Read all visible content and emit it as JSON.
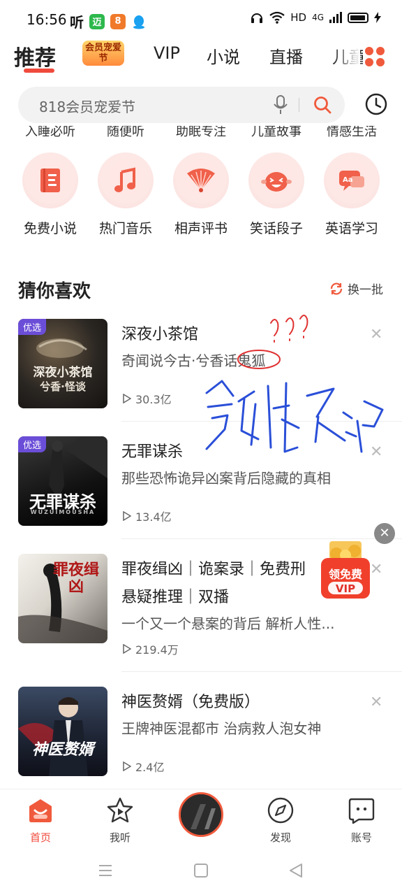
{
  "status_bar": {
    "time": "16:56",
    "app_icons": [
      "听",
      "迈",
      "8"
    ],
    "network": "HD",
    "signal": "4G"
  },
  "tabs": [
    {
      "label": "推荐",
      "active": true
    },
    {
      "label": "会员宠爱节",
      "promo": true
    },
    {
      "label": "VIP"
    },
    {
      "label": "小说"
    },
    {
      "label": "直播"
    },
    {
      "label": "儿童"
    }
  ],
  "search": {
    "placeholder": "818会员宠爱节"
  },
  "categories_top_cut": [
    "入睡必听",
    "随便听",
    "助眠专注",
    "儿童故事",
    "情感生活"
  ],
  "categories": [
    {
      "label": "免费小说",
      "icon": "book-icon"
    },
    {
      "label": "热门音乐",
      "icon": "music-icon"
    },
    {
      "label": "相声评书",
      "icon": "fan-icon"
    },
    {
      "label": "笑话段子",
      "icon": "laugh-icon"
    },
    {
      "label": "英语学习",
      "icon": "english-icon"
    }
  ],
  "section": {
    "title": "猜你喜欢",
    "refresh": "换一批"
  },
  "items": [
    {
      "tag": "优选",
      "cover_text": "深夜小茶馆",
      "cover_sub": "兮香·怪谈",
      "title": "深夜小茶馆",
      "desc": "奇闻说今古·兮香话鬼狐",
      "plays": "30.3亿"
    },
    {
      "tag": "优选",
      "cover_text": "无罪谋杀",
      "cover_sub": "WUZUIMOUSHA",
      "title": "无罪谋杀",
      "desc": "那些恐怖诡异凶案背后隐藏的真相",
      "plays": "13.4亿"
    },
    {
      "tag": "",
      "cover_text": "罪夜缉凶",
      "cover_sub": "",
      "title": "罪夜缉凶｜诡案录｜免费刑",
      "title2": "悬疑推理｜双播",
      "desc": "一个又一个悬案的背后 解析人性...",
      "plays": "219.4万"
    },
    {
      "tag": "",
      "cover_text": "神医赘婿",
      "cover_sub": "",
      "title": "神医赘婿（免费版）",
      "desc": "王牌神医混都市 治病救人泡女神",
      "plays": "2.4亿"
    }
  ],
  "vip_float": {
    "line1": "领免费",
    "line2": "VIP"
  },
  "annotations": {
    "question": "???",
    "handwriting": "鬼狐天冲"
  },
  "bottom_nav": [
    {
      "label": "首页",
      "icon": "home-icon",
      "active": true
    },
    {
      "label": "我听",
      "icon": "star-play-icon"
    },
    {
      "label": "",
      "icon": "now-playing-icon"
    },
    {
      "label": "发现",
      "icon": "compass-icon"
    },
    {
      "label": "账号",
      "icon": "account-icon"
    }
  ],
  "colors": {
    "accent": "#f04a3c",
    "tag": "#6b4ed8",
    "annotation_red": "#e03030",
    "annotation_blue": "#2a4fd8"
  }
}
